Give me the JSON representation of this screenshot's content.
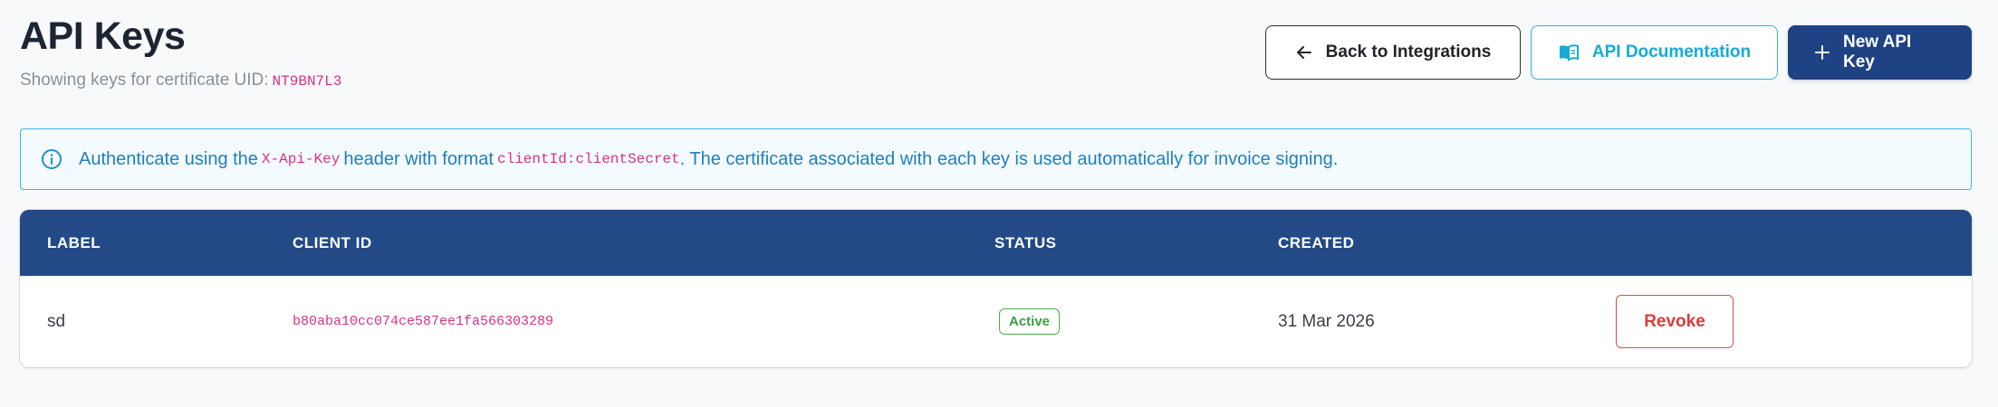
{
  "header": {
    "title": "API Keys",
    "subtitle_prefix": "Showing keys for certificate UID:",
    "certificate_uid": "NT9BN7L3"
  },
  "actions": {
    "back_label": "Back to Integrations",
    "docs_label": "API Documentation",
    "new_label": "New API Key"
  },
  "alert": {
    "text_1": "Authenticate using the",
    "header_name": "X-Api-Key",
    "text_2": "header with format",
    "format": "clientId:clientSecret",
    "text_3": ". The certificate associated with each key is used automatically for invoice signing."
  },
  "table": {
    "columns": [
      "LABEL",
      "CLIENT ID",
      "STATUS",
      "CREATED"
    ],
    "rows": [
      {
        "label": "sd",
        "client_id": "b80aba10cc074ce587ee1fa566303289",
        "status": "Active",
        "created": "31 Mar 2026",
        "action_label": "Revoke"
      }
    ]
  },
  "colors": {
    "primary": "#1e4283",
    "table_header": "#234a87",
    "info": "#3cb6e5",
    "accent_code": "#d63384",
    "success": "#4caf50",
    "danger": "#e04b4b"
  },
  "icons": {
    "back": "arrow-left-icon",
    "docs": "book-icon",
    "new": "plus-icon",
    "alert": "info-circle-icon"
  }
}
